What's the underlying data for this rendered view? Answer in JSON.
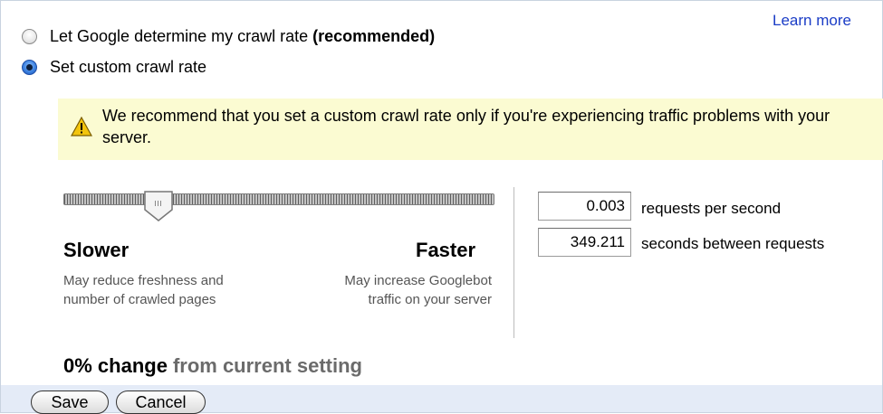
{
  "header": {
    "learn_more": "Learn more"
  },
  "options": {
    "google": {
      "label": "Let Google determine my crawl rate",
      "note": "(recommended)",
      "checked": false
    },
    "custom": {
      "label": "Set custom crawl rate",
      "checked": true
    }
  },
  "warning": {
    "icon": "warning-triangle-icon",
    "text": "We recommend that you set a custom crawl rate only if you're experiencing traffic problems with your server."
  },
  "slider": {
    "slower_label": "Slower",
    "slower_desc": "May reduce freshness and number of crawled pages",
    "faster_label": "Faster",
    "faster_desc": "May increase Googlebot traffic on your server",
    "position_fraction": 0.2
  },
  "rates": {
    "requests_per_second": "0.003",
    "requests_per_second_label": "requests per second",
    "seconds_between": "349.211",
    "seconds_between_label": "seconds between requests"
  },
  "change": {
    "percent": "0% change",
    "suffix": "from current setting"
  },
  "buttons": {
    "save": "Save",
    "cancel": "Cancel"
  },
  "colors": {
    "link": "#1a3cc6",
    "warning_bg": "#fbfbd2",
    "footer_bg": "#e4ebf7"
  }
}
